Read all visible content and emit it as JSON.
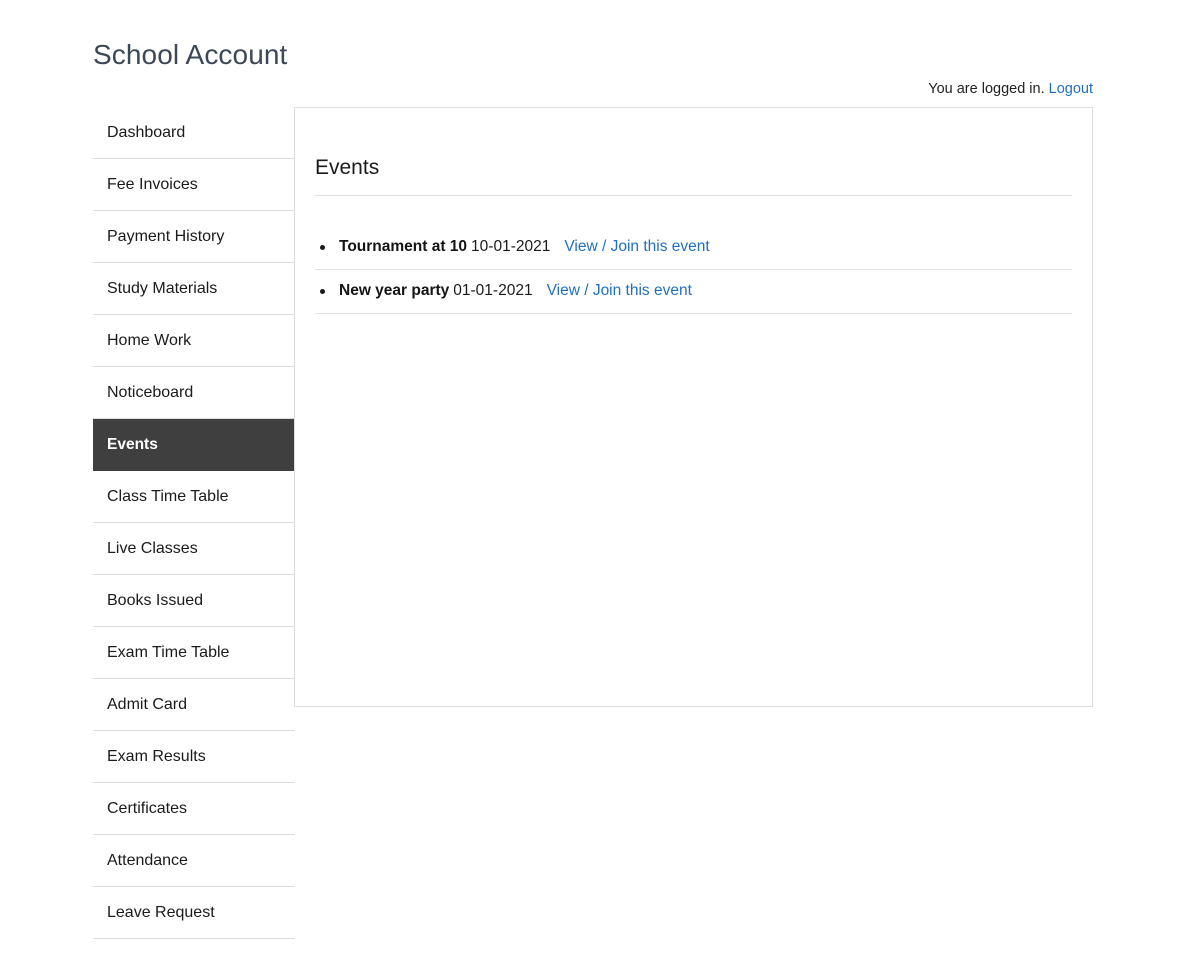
{
  "header": {
    "title": "School Account",
    "login_status_text": "You are logged in.",
    "logout_label": "Logout"
  },
  "sidebar": {
    "items": [
      {
        "label": "Dashboard",
        "active": false
      },
      {
        "label": "Fee Invoices",
        "active": false
      },
      {
        "label": "Payment History",
        "active": false
      },
      {
        "label": "Study Materials",
        "active": false
      },
      {
        "label": "Home Work",
        "active": false
      },
      {
        "label": "Noticeboard",
        "active": false
      },
      {
        "label": "Events",
        "active": true
      },
      {
        "label": "Class Time Table",
        "active": false
      },
      {
        "label": "Live Classes",
        "active": false
      },
      {
        "label": "Books Issued",
        "active": false
      },
      {
        "label": "Exam Time Table",
        "active": false
      },
      {
        "label": "Admit Card",
        "active": false
      },
      {
        "label": "Exam Results",
        "active": false
      },
      {
        "label": "Certificates",
        "active": false
      },
      {
        "label": "Attendance",
        "active": false
      },
      {
        "label": "Leave Request",
        "active": false
      }
    ]
  },
  "main": {
    "heading": "Events",
    "events": [
      {
        "name": "Tournament at 10",
        "date": "10-01-2021",
        "link_label": "View / Join this event"
      },
      {
        "name": "New year party",
        "date": "01-01-2021",
        "link_label": "View / Join this event"
      }
    ]
  },
  "colors": {
    "link": "#1f6fc4",
    "active_nav_bg": "#3f3f3f",
    "title": "#3c4858",
    "border": "#dcdcdc"
  }
}
